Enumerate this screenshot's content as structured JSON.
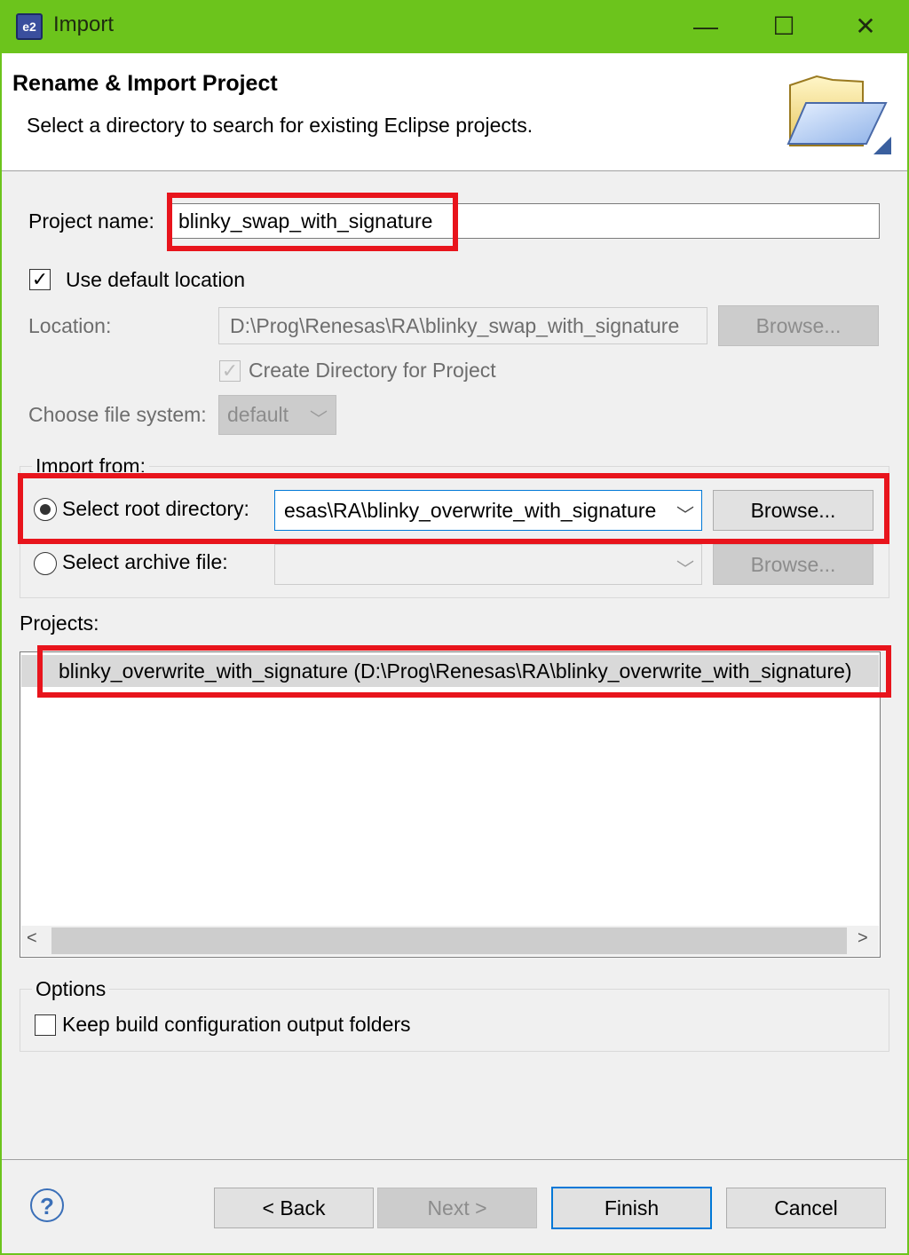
{
  "window": {
    "title": "Import",
    "app_icon": "e2",
    "minimize_glyph": "—",
    "maximize_glyph": "☐",
    "close_glyph": "✕"
  },
  "banner": {
    "title": "Rename & Import Project",
    "description": "Select a directory to search for existing Eclipse projects."
  },
  "project_name": {
    "label": "Project name:",
    "value": "blinky_swap_with_signature"
  },
  "use_default_location": {
    "label": "Use default location",
    "checked": true
  },
  "location": {
    "label": "Location:",
    "value": "D:\\Prog\\Renesas\\RA\\blinky_swap_with_signature",
    "browse": "Browse..."
  },
  "create_directory": {
    "label": "Create Directory for Project",
    "checked": true
  },
  "file_system": {
    "label": "Choose file system:",
    "value": "default"
  },
  "import_from": {
    "label": "Import from:",
    "root_directory": {
      "label": "Select root directory:",
      "value": "esas\\RA\\blinky_overwrite_with_signature",
      "browse": "Browse...",
      "selected": true
    },
    "archive_file": {
      "label": "Select archive file:",
      "value": "",
      "browse": "Browse...",
      "selected": false
    }
  },
  "projects": {
    "label": "Projects:",
    "items": [
      "blinky_overwrite_with_signature (D:\\Prog\\Renesas\\RA\\blinky_overwrite_with_signature)"
    ]
  },
  "options": {
    "label": "Options",
    "keep_build": {
      "label": "Keep build configuration output folders",
      "checked": false
    }
  },
  "footer": {
    "help": "?",
    "back": "< Back",
    "next": "Next >",
    "finish": "Finish",
    "cancel": "Cancel"
  },
  "colors": {
    "titlebar": "#6cc41c",
    "highlight": "#e8141c",
    "focus": "#0078d7"
  }
}
